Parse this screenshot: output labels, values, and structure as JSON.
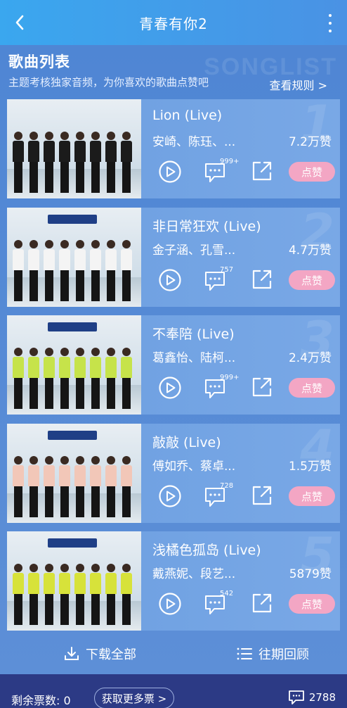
{
  "header": {
    "title": "青春有你2"
  },
  "section": {
    "title": "歌曲列表",
    "watermark": "SONGLIST",
    "subtitle": "主题考核独家音频，为你喜欢的歌曲点赞吧",
    "rules_link": "查看规则 >"
  },
  "songs": [
    {
      "rank": "1",
      "name": "Lion (Live)",
      "artists": "安崎、陈珏、...",
      "votes": "7.2万赞",
      "comments": "999+",
      "like_label": "点赞",
      "shirt_color": "#1b1b1b"
    },
    {
      "rank": "2",
      "name": "非日常狂欢 (Live)",
      "artists": "金子涵、孔雪...",
      "votes": "4.7万赞",
      "comments": "757",
      "like_label": "点赞",
      "shirt_color": "#f4f4f4"
    },
    {
      "rank": "3",
      "name": "不奉陪 (Live)",
      "artists": "葛鑫怡、陆柯...",
      "votes": "2.4万赞",
      "comments": "999+",
      "like_label": "点赞",
      "shirt_color": "#c6e34a"
    },
    {
      "rank": "4",
      "name": "敲敲 (Live)",
      "artists": "傅如乔、蔡卓...",
      "votes": "1.5万赞",
      "comments": "728",
      "like_label": "点赞",
      "shirt_color": "#f2c7b8"
    },
    {
      "rank": "5",
      "name": "浅橘色孤岛 (Live)",
      "artists": "戴燕妮、段艺...",
      "votes": "5879赞",
      "comments": "542",
      "like_label": "点赞",
      "shirt_color": "#d7e23a"
    }
  ],
  "footer": {
    "download_all": "下载全部",
    "history": "往期回顾"
  },
  "bottom": {
    "tickets": "剩余票数: 0",
    "get_more": "获取更多票 >",
    "message_count": "2788"
  },
  "colors": {
    "header": "#3aa7ef",
    "background": "#5b8fd6",
    "like": "#f3a6c4",
    "bottom_bar": "#2c3a85"
  }
}
